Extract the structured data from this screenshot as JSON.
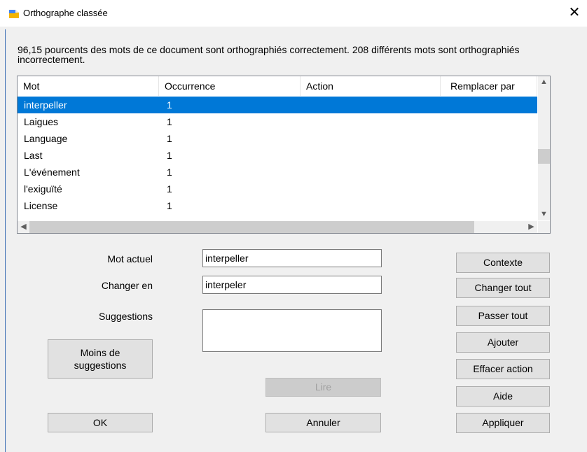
{
  "window": {
    "title": "Orthographe classée",
    "close_label": "✕"
  },
  "info_text": "96,15 pourcents des mots de ce document sont orthographiés correctement. 208 différents mots sont orthographiés incorrectement.",
  "table": {
    "columns": [
      "Mot",
      "Occurrence",
      "Action",
      "Remplacer par"
    ],
    "rows": [
      {
        "mot": "interpeller",
        "occurrence": "1",
        "action": "",
        "remplacer": "",
        "selected": true
      },
      {
        "mot": "Laigues",
        "occurrence": "1",
        "action": "",
        "remplacer": ""
      },
      {
        "mot": "Language",
        "occurrence": "1",
        "action": "",
        "remplacer": ""
      },
      {
        "mot": "Last",
        "occurrence": "1",
        "action": "",
        "remplacer": ""
      },
      {
        "mot": "L'événement",
        "occurrence": "1",
        "action": "",
        "remplacer": ""
      },
      {
        "mot": "l'exiguïté",
        "occurrence": "1",
        "action": "",
        "remplacer": ""
      },
      {
        "mot": "License",
        "occurrence": "1",
        "action": "",
        "remplacer": ""
      }
    ]
  },
  "form": {
    "mot_actuel_label": "Mot actuel",
    "mot_actuel_value": "interpeller",
    "changer_en_label": "Changer en",
    "changer_en_value": "interpeler",
    "suggestions_label": "Suggestions"
  },
  "buttons": {
    "moins_de_suggestions": "Moins de\nsuggestions",
    "ok": "OK",
    "lire": "Lire",
    "annuler": "Annuler",
    "contexte": "Contexte",
    "changer_tout": "Changer tout",
    "passer_tout": "Passer tout",
    "ajouter": "Ajouter",
    "effacer_action": "Effacer action",
    "aide": "Aide",
    "appliquer": "Appliquer"
  },
  "colors": {
    "selection": "#0078d7",
    "accent": "#3c6fb5"
  }
}
